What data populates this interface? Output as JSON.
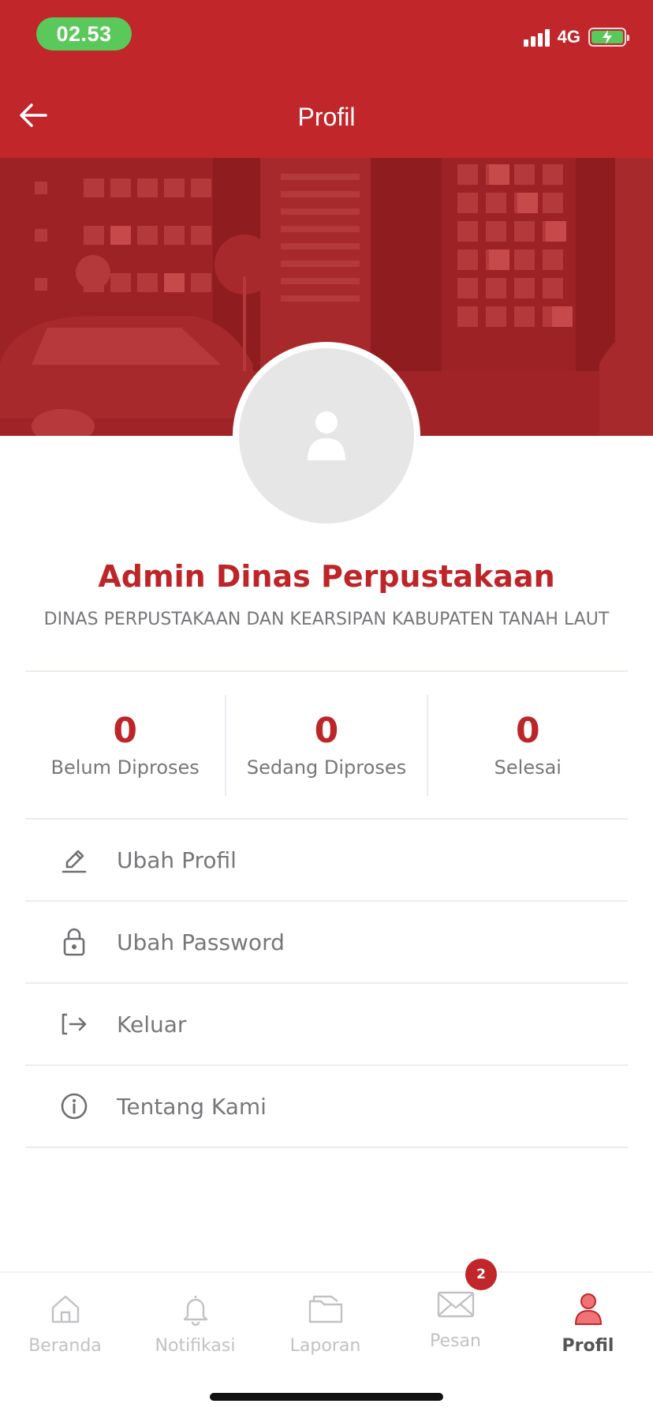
{
  "status_bar": {
    "time": "02.53",
    "network": "4G",
    "colors": {
      "time_pill": "#5ac85a",
      "battery": "#5ac85a"
    }
  },
  "header": {
    "title": "Profil",
    "back_icon": "arrow-left-icon",
    "background_color": "#c0262a"
  },
  "profile": {
    "name": "Admin Dinas Perpustakaan",
    "agency": "DINAS PERPUSTAKAAN DAN KEARSIPAN KABUPATEN TANAH LAUT",
    "avatar_icon": "user-icon",
    "accent_color": "#bd2529"
  },
  "stats": [
    {
      "value": "0",
      "label": "Belum Diproses"
    },
    {
      "value": "0",
      "label": "Sedang Diproses"
    },
    {
      "value": "0",
      "label": "Selesai"
    }
  ],
  "menu": [
    {
      "label": "Ubah Profil",
      "icon": "pencil-icon"
    },
    {
      "label": "Ubah Password",
      "icon": "lock-icon"
    },
    {
      "label": "Keluar",
      "icon": "logout-icon"
    },
    {
      "label": "Tentang Kami",
      "icon": "info-icon"
    }
  ],
  "bottom_nav": {
    "items": [
      {
        "label": "Beranda",
        "icon": "home-icon"
      },
      {
        "label": "Notifikasi",
        "icon": "bell-icon"
      },
      {
        "label": "Laporan",
        "icon": "folder-icon"
      },
      {
        "label": "Pesan",
        "icon": "mail-icon"
      },
      {
        "label": "Profil",
        "icon": "user-icon",
        "active": true
      }
    ],
    "message_badge": "2"
  }
}
